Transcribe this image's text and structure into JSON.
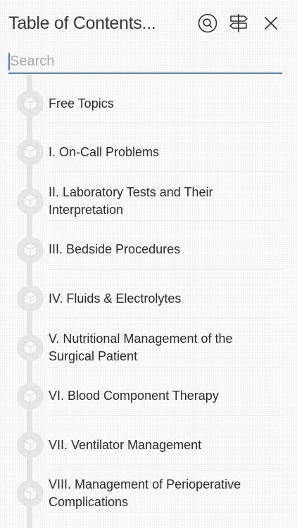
{
  "header": {
    "title": "Table of Contents...",
    "icons": [
      "search-icon",
      "signpost-icon",
      "close-icon"
    ]
  },
  "search": {
    "placeholder": "Search",
    "value": ""
  },
  "toc": {
    "item_icon": "cube-icon",
    "items": [
      {
        "label": "Free Topics"
      },
      {
        "label": "I. On-Call Problems"
      },
      {
        "label": "II. Laboratory Tests and Their Interpretation"
      },
      {
        "label": "III. Bedside Procedures"
      },
      {
        "label": "IV. Fluids & Electrolytes"
      },
      {
        "label": "V. Nutritional Management of the Surgical Patient"
      },
      {
        "label": "VI. Blood Component Therapy"
      },
      {
        "label": "VII. Ventilator Management"
      },
      {
        "label": "VIII. Management of Perioperative Complications"
      }
    ]
  },
  "colors": {
    "accent": "#5a7fa6",
    "caret": "#4a74c8",
    "timeline": "#e4e4e4",
    "node": "#e6e6e6"
  }
}
